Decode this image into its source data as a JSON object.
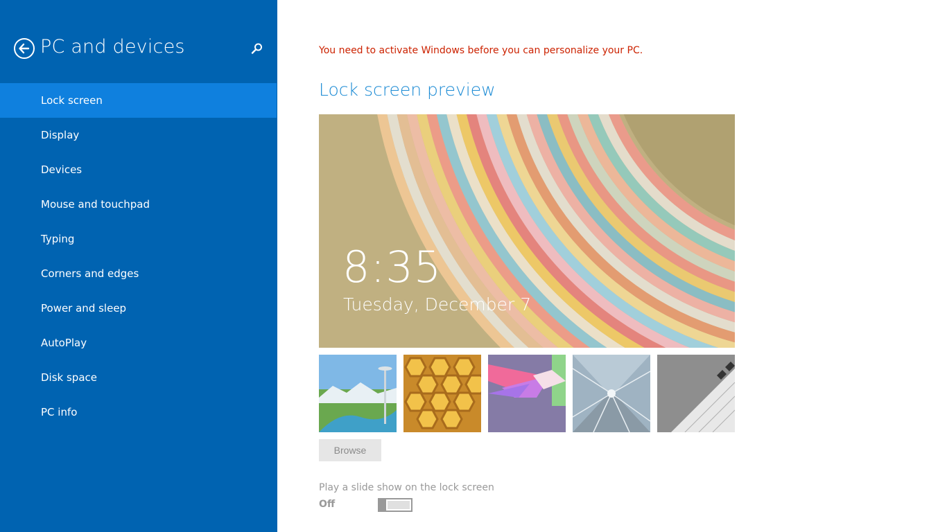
{
  "sidebar": {
    "title": "PC and devices",
    "back_icon": "back-arrow-icon",
    "search_icon": "search-icon",
    "active_item": "Lock screen",
    "items": [
      {
        "label": "Lock screen"
      },
      {
        "label": "Display"
      },
      {
        "label": "Devices"
      },
      {
        "label": "Mouse and touchpad"
      },
      {
        "label": "Typing"
      },
      {
        "label": "Corners and edges"
      },
      {
        "label": "Power and sleep"
      },
      {
        "label": "AutoPlay"
      },
      {
        "label": "Disk space"
      },
      {
        "label": "PC info"
      }
    ]
  },
  "main": {
    "activation_warning": "You need to activate Windows before you can personalize your PC.",
    "section_title": "Lock screen preview",
    "preview": {
      "time": "8:35",
      "date": "Tuesday, December 7"
    },
    "thumbnails": [
      {
        "name": "seattle-space-needle"
      },
      {
        "name": "honeycomb"
      },
      {
        "name": "colored-shapes"
      },
      {
        "name": "motion-tunnel"
      },
      {
        "name": "piano-keys"
      }
    ],
    "browse_label": "Browse",
    "slideshow": {
      "label": "Play a slide show on the lock screen",
      "state": "Off"
    }
  },
  "colors": {
    "sidebar_bg": "#0063b1",
    "sidebar_active": "#0f80de",
    "warning": "#cc2200",
    "title_accent": "#1a8ad4"
  }
}
